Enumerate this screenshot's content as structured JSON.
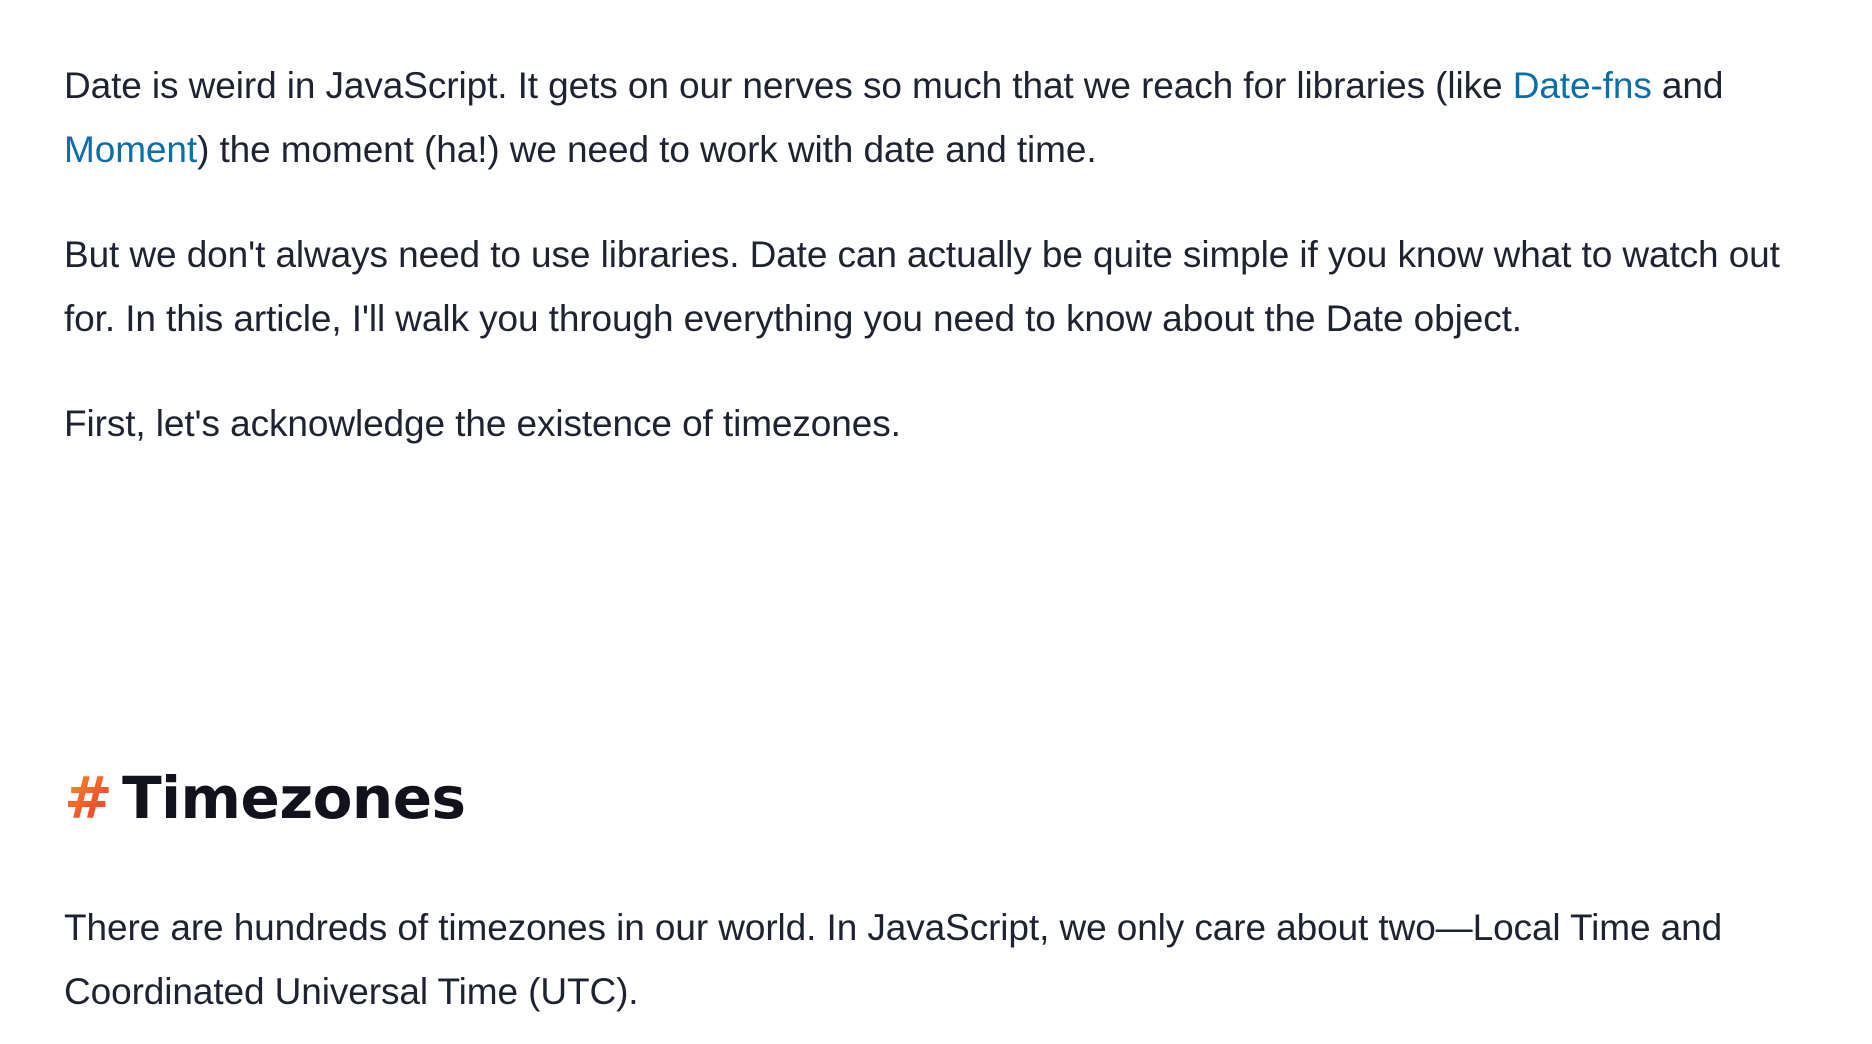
{
  "intro": {
    "p1": {
      "text_a": "Date is weird in JavaScript. It gets on our nerves so much that we reach for libraries (like ",
      "link_datefns": "Date-fns",
      "text_b": " and ",
      "link_moment": "Moment",
      "text_c": ") the moment (ha!) we need to work with date and time."
    },
    "p2": "But we don't always need to use libraries. Date can actually be quite simple if you know what to watch out for. In this article, I'll walk you through everything you need to know about the Date object.",
    "p3": "First, let's acknowledge the existence of timezones."
  },
  "section": {
    "hash": "#",
    "title": "Timezones",
    "p1": "There are hundreds of timezones in our world. In JavaScript, we only care about two—Local Time and Coordinated Universal Time (UTC)."
  },
  "colors": {
    "text": "#1f2330",
    "link": "#0b6ea8",
    "heading": "#12121c",
    "hash_gradient": [
      "#f7a12a",
      "#ef5a2b",
      "#e0352b"
    ]
  }
}
